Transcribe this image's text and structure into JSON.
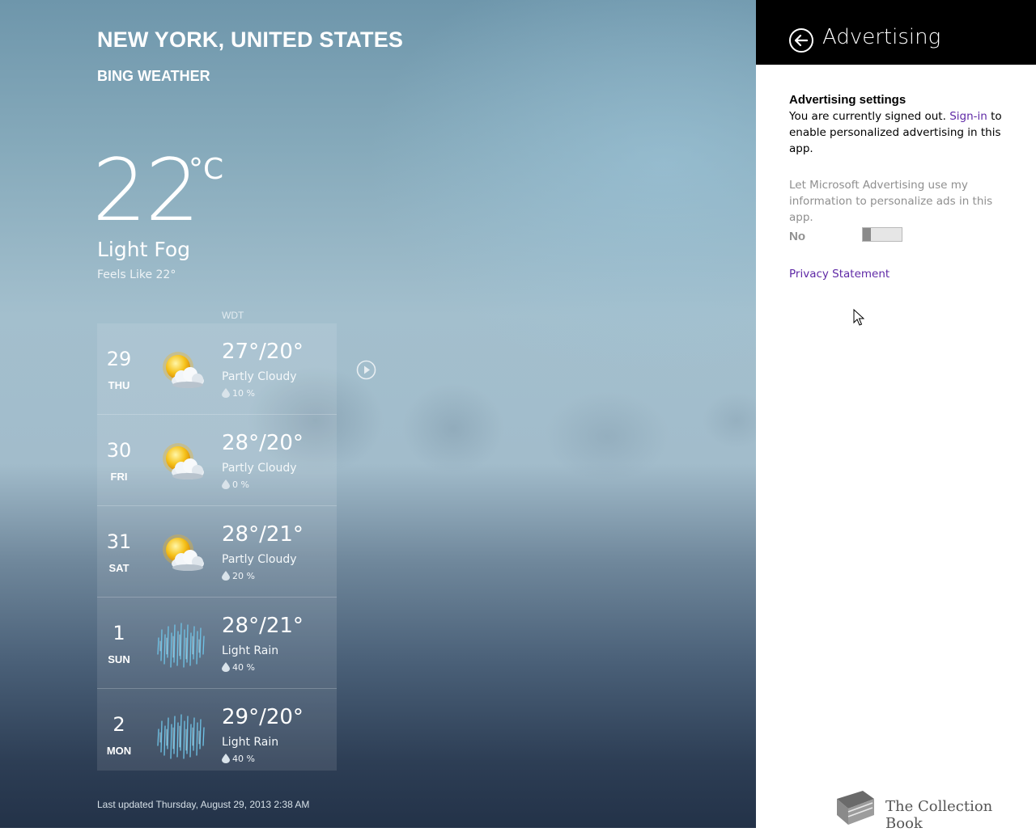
{
  "app": {
    "location": "NEW YORK, UNITED STATES",
    "provider": "BING WEATHER",
    "current": {
      "temp": "22",
      "unit": "°C",
      "condition": "Light Fog",
      "feels_like": "Feels Like 22°"
    },
    "timezone": "WDT",
    "forecast": [
      {
        "day": "29",
        "dow": "THU",
        "hilo": "27°/20°",
        "cond": "Partly Cloudy",
        "precip": "10 %",
        "icon": "partly-cloudy-icon"
      },
      {
        "day": "30",
        "dow": "FRI",
        "hilo": "28°/20°",
        "cond": "Partly Cloudy",
        "precip": "0 %",
        "icon": "partly-cloudy-icon"
      },
      {
        "day": "31",
        "dow": "SAT",
        "hilo": "28°/21°",
        "cond": "Partly Cloudy",
        "precip": "20 %",
        "icon": "partly-cloudy-icon"
      },
      {
        "day": "1",
        "dow": "SUN",
        "hilo": "28°/21°",
        "cond": "Light Rain",
        "precip": "40 %",
        "icon": "light-rain-icon"
      },
      {
        "day": "2",
        "dow": "MON",
        "hilo": "29°/20°",
        "cond": "Light Rain",
        "precip": "40 %",
        "icon": "light-rain-icon"
      }
    ],
    "last_updated": "Last updated Thursday, August 29, 2013 2:38 AM"
  },
  "panel": {
    "title": "Advertising",
    "settings_heading": "Advertising settings",
    "signed_out_text": "You are currently signed out.",
    "signin_link": "Sign-in",
    "signin_suffix": "to enable personalized advertising in this app.",
    "toggle_label": "Let Microsoft Advertising use my information to personalize ads in this app.",
    "toggle_state": "No",
    "toggle_on": false,
    "privacy_link": "Privacy Statement"
  },
  "watermark": "The Collection Book",
  "colors": {
    "link": "#5f29a6",
    "panel_header": "#000000",
    "disabled_text": "#8f8f8f"
  }
}
